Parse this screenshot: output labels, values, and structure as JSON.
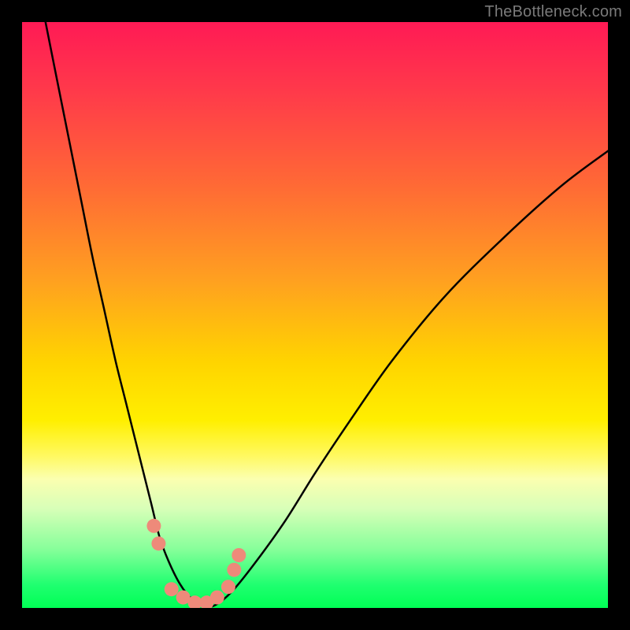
{
  "watermark": {
    "text": "TheBottleneck.com"
  },
  "chart_data": {
    "type": "line",
    "title": "",
    "xlabel": "",
    "ylabel": "",
    "xlim": [
      0,
      100
    ],
    "ylim": [
      0,
      100
    ],
    "series": [
      {
        "name": "bottleneck-curve",
        "x": [
          4,
          6,
          8,
          10,
          12,
          14,
          16,
          18,
          20,
          22,
          23.5,
          25,
          27,
          29,
          31,
          33,
          36,
          40,
          45,
          50,
          56,
          63,
          72,
          82,
          92,
          100
        ],
        "y": [
          100,
          90,
          80,
          70,
          60,
          51,
          42,
          34,
          26,
          18,
          12,
          8,
          4,
          1.5,
          0.3,
          0.5,
          3,
          8,
          15,
          23,
          32,
          42,
          53,
          63,
          72,
          78
        ]
      }
    ],
    "markers": {
      "name": "highlight-dots",
      "color": "#ee8a7a",
      "points": [
        {
          "x": 22.5,
          "y": 14
        },
        {
          "x": 23.3,
          "y": 11
        },
        {
          "x": 25.5,
          "y": 3.2
        },
        {
          "x": 27.5,
          "y": 1.8
        },
        {
          "x": 29.5,
          "y": 0.9
        },
        {
          "x": 31.5,
          "y": 0.9
        },
        {
          "x": 33.3,
          "y": 1.8
        },
        {
          "x": 35.2,
          "y": 3.6
        },
        {
          "x": 36.2,
          "y": 6.5
        },
        {
          "x": 37.0,
          "y": 9.0
        }
      ]
    },
    "gradient_stops": [
      {
        "pos": 0,
        "color": "#ff1a55"
      },
      {
        "pos": 58,
        "color": "#ffd400"
      },
      {
        "pos": 100,
        "color": "#00ff55"
      }
    ]
  }
}
